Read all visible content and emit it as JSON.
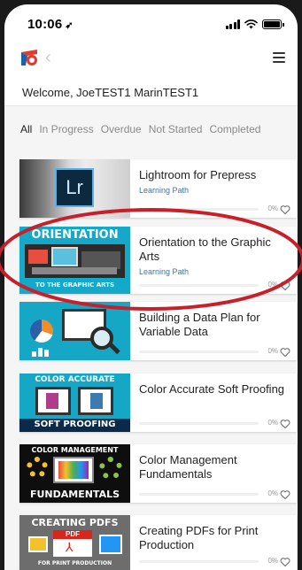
{
  "status_bar": {
    "time": "10:06",
    "location_glyph": "➶"
  },
  "nav": {
    "back_glyph": "‹"
  },
  "welcome": "Welcome, JoeTEST1 MarinTEST1",
  "tabs": [
    {
      "label": "All",
      "active": true
    },
    {
      "label": "In Progress",
      "active": false
    },
    {
      "label": "Overdue",
      "active": false
    },
    {
      "label": "Not Started",
      "active": false
    },
    {
      "label": "Completed",
      "active": false
    }
  ],
  "courses": [
    {
      "title": "Lightroom for Prepress",
      "subtitle": "Learning Path",
      "progress": 0,
      "progress_label": "0%",
      "thumb_text": [
        "Lr"
      ]
    },
    {
      "title": "Orientation to the Graphic Arts",
      "subtitle": "Learning Path",
      "progress": 0,
      "progress_label": "0%",
      "thumb_text": [
        "ORIENTATION",
        "TO THE GRAPHIC ARTS"
      ]
    },
    {
      "title": "Building a Data Plan for Variable Data",
      "subtitle": "",
      "progress": 0,
      "progress_label": "0%",
      "thumb_text": []
    },
    {
      "title": "Color Accurate Soft Proofing",
      "subtitle": "",
      "progress": 0,
      "progress_label": "0%",
      "thumb_text": [
        "COLOR ACCURATE",
        "SOFT PROOFING"
      ]
    },
    {
      "title": "Color Management Fundamentals",
      "subtitle": "",
      "progress": 0,
      "progress_label": "0%",
      "thumb_text": [
        "COLOR MANAGEMENT",
        "FUNDAMENTALS"
      ]
    },
    {
      "title": "Creating PDFs for Print Production",
      "subtitle": "",
      "progress": 0,
      "progress_label": "0%",
      "thumb_text": [
        "CREATING PDFS",
        "PDF",
        "FOR PRINT PRODUCTION"
      ]
    }
  ],
  "colors": {
    "accent_blue": "#2a7ab8",
    "annotation_red": "#c8202a",
    "logo_red": "#e23a2c",
    "logo_blue": "#1f5fa8"
  },
  "icons": {
    "menu": "hamburger-icon",
    "favorite": "heart-outline-icon",
    "back": "chevron-left-icon"
  }
}
